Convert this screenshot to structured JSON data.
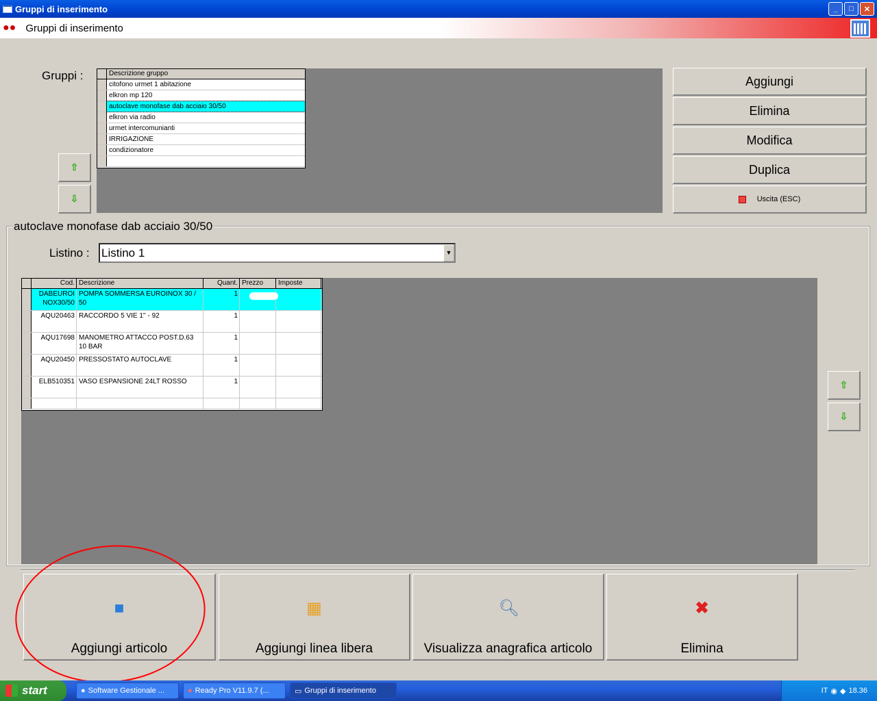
{
  "window": {
    "title": "Gruppi di inserimento",
    "minimize": "_",
    "maximize": "□",
    "close": "✕"
  },
  "header": {
    "title": "Gruppi di inserimento"
  },
  "groups": {
    "label": "Gruppi :",
    "column_header": "Descrizione gruppo",
    "rows": [
      "citofono urmet 1 abitazione",
      "elkron  mp 120",
      "autoclave monofase dab acciaio 30/50",
      "elkron via radio",
      "urmet  intercomunianti",
      "IRRIGAZIONE",
      "condizionatore",
      ""
    ],
    "selected_index": 2
  },
  "side_buttons": {
    "add": "Aggiungi",
    "delete": "Elimina",
    "edit": "Modifica",
    "duplicate": "Duplica",
    "exit": "Uscita (ESC)"
  },
  "detail": {
    "title": "autoclave monofase dab acciaio 30/50",
    "listino_label": "Listino :",
    "listino_value": "Listino 1",
    "columns": [
      "Cod.",
      "Descrizione",
      "Quant.",
      "Prezzo",
      "Imposte"
    ],
    "rows": [
      {
        "cod": "DABEUROI NOX30/50",
        "desc": "POMPA SOMMERSA  EUROINOX 30 / 50",
        "qty": "1",
        "price": "",
        "tax": ""
      },
      {
        "cod": "AQU20463",
        "desc": "RACCORDO 5 VIE   1''    -  92",
        "qty": "1",
        "price": "",
        "tax": ""
      },
      {
        "cod": "AQU17698",
        "desc": "MANOMETRO ATTACCO POST.D.63 10 BAR",
        "qty": "1",
        "price": "",
        "tax": ""
      },
      {
        "cod": "AQU20450",
        "desc": "PRESSOSTATO AUTOCLAVE",
        "qty": "1",
        "price": "",
        "tax": ""
      },
      {
        "cod": "ELB510351",
        "desc": "VASO ESPANSIONE 24LT ROSSO",
        "qty": "1",
        "price": "",
        "tax": ""
      }
    ]
  },
  "bottom_buttons": {
    "add_article": "Aggiungi articolo",
    "add_free_line": "Aggiungi linea libera",
    "view_article": "Visualizza anagrafica articolo",
    "delete": "Elimina"
  },
  "taskbar": {
    "start": "start",
    "tasks": [
      "Software Gestionale ...",
      "Ready Pro V11.9.7 (...",
      "Gruppi di inserimento"
    ],
    "lang": "IT",
    "clock": "18.36"
  }
}
